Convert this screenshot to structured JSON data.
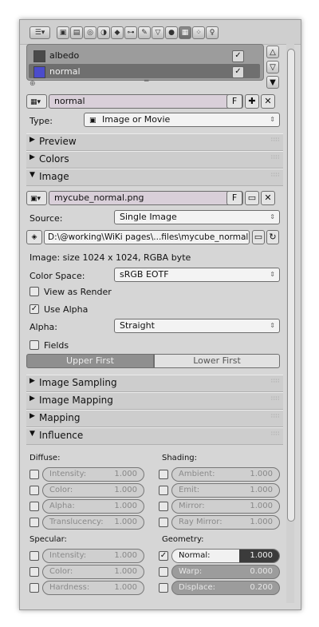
{
  "toolbar": {
    "icons": [
      "view-icon",
      "scene-icon",
      "world-icon",
      "object-icon",
      "constraint-icon",
      "modifier-icon",
      "data-icon",
      "material-icon",
      "texture-icon",
      "particles-icon",
      "physics-icon"
    ],
    "active": "texture-icon"
  },
  "slots": [
    {
      "label": "albedo",
      "swatch": "#4a4a4a",
      "checked": true
    },
    {
      "label": "normal",
      "swatch": "#4b4ccb",
      "checked": true
    }
  ],
  "texture": {
    "name": "normal",
    "f_label": "F",
    "type_label": "Type:",
    "type_value": "Image or Movie"
  },
  "panels": {
    "preview": "Preview",
    "colors": "Colors",
    "image": "Image",
    "image_sampling": "Image Sampling",
    "image_mapping": "Image Mapping",
    "mapping": "Mapping",
    "influence": "Influence"
  },
  "image": {
    "file": "mycube_normal.png",
    "f_label": "F",
    "source_label": "Source:",
    "source_value": "Single Image",
    "path": "D:\\@working\\WiKi pages\\...files\\mycube_normal.png",
    "info": "Image: size 1024 x 1024, RGBA byte",
    "colorspace_label": "Color Space:",
    "colorspace_value": "sRGB EOTF",
    "view_as_render": "View as Render",
    "use_alpha": "Use Alpha",
    "alpha_label": "Alpha:",
    "alpha_value": "Straight",
    "fields": "Fields",
    "upper_first": "Upper First",
    "lower_first": "Lower First"
  },
  "influence": {
    "diffuse_label": "Diffuse:",
    "shading_label": "Shading:",
    "specular_label": "Specular:",
    "geometry_label": "Geometry:",
    "diffuse": [
      {
        "name": "Intensity:",
        "value": "1.000"
      },
      {
        "name": "Color:",
        "value": "1.000"
      },
      {
        "name": "Alpha:",
        "value": "1.000"
      },
      {
        "name": "Translucency:",
        "value": "1.000"
      }
    ],
    "shading": [
      {
        "name": "Ambient:",
        "value": "1.000"
      },
      {
        "name": "Emit:",
        "value": "1.000"
      },
      {
        "name": "Mirror:",
        "value": "1.000"
      },
      {
        "name": "Ray Mirror:",
        "value": "1.000"
      }
    ],
    "specular": [
      {
        "name": "Intensity:",
        "value": "1.000"
      },
      {
        "name": "Color:",
        "value": "1.000"
      },
      {
        "name": "Hardness:",
        "value": "1.000"
      }
    ],
    "geometry": [
      {
        "name": "Normal:",
        "value": "1.000"
      },
      {
        "name": "Warp:",
        "value": "0.000"
      },
      {
        "name": "Displace:",
        "value": "0.200"
      }
    ]
  }
}
